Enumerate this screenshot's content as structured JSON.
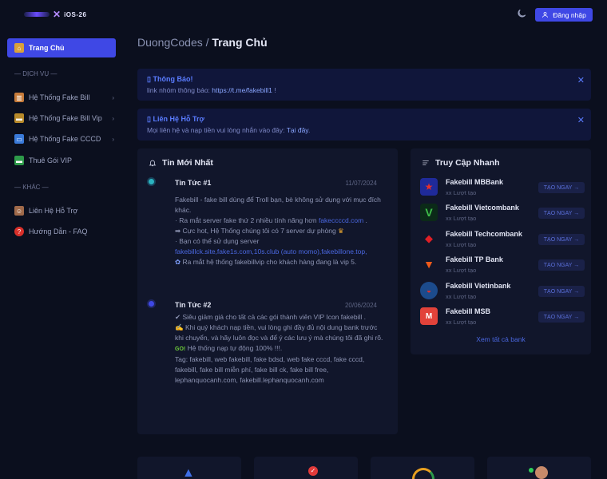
{
  "header": {
    "logo_text": "iOS-26",
    "login_label": "Đăng nhập"
  },
  "sidebar": {
    "active": {
      "label": "Trang Chủ"
    },
    "section_services": "— DỊCH VỤ —",
    "services": [
      {
        "label": "Hệ Thống Fake Bill"
      },
      {
        "label": "Hệ Thống Fake Bill Vip"
      },
      {
        "label": "Hệ Thống Fake CCCD"
      },
      {
        "label": "Thuê Gói VIP"
      }
    ],
    "section_other": "— KHÁC —",
    "other": [
      {
        "label": "Liên Hệ Hỗ Trợ"
      },
      {
        "label": "Hướng Dẫn - FAQ"
      }
    ]
  },
  "breadcrumb": {
    "root": "DuongCodes",
    "sep": " / ",
    "current": "Trang Chủ"
  },
  "alerts": [
    {
      "title": "Thông Báo!",
      "text": "link nhóm thông báo: ",
      "link": "https://t.me/fakebill1",
      "suffix": " !"
    },
    {
      "title": "Liên Hệ Hỗ Trợ",
      "text": "Mọi liên hệ và nạp tiền vui lòng nhắn vào đây: ",
      "link": "Tại đây"
    }
  ],
  "news": {
    "title": "Tin Mới Nhất",
    "items": [
      {
        "title": "Tin Tức #1",
        "date": "11/07/2024",
        "l1": "Fakebill - fake bill dùng để Troll bạn, bè không sử dụng với mục đích khác.",
        "l2": "Ra mắt server fake thứ 2 nhiều tính năng hơn ",
        "l2_link": "fakeccccd.com",
        "l2_end": " .",
        "l3": "➡ Cực hot, Hệ Thống chúng tôi có 7 server dự phòng ",
        "l4": "Bạn có thể sử dụng server",
        "l5_link": "fakebillck.site,fake1s.com,10s.club (auto momo),fakebillone.top,",
        "l6": "Ra mắt hệ thống fakebillvip cho khách hàng đang là vip 5."
      },
      {
        "title": "Tin Tức #2",
        "date": "20/06/2024",
        "l1": "✔ Siêu giảm giá cho tất cả các gói thành viên VIP Icon fakebill .",
        "l2": "Khi quý khách nạp tiền, vui lòng ghi đầy đủ nội dung bank trước khi chuyển, và hãy luôn đọc và để ý các lưu ý mà chúng tôi đã ghi rõ.",
        "l3": "Hệ thống nạp tự động 100% !!!.",
        "l4": "Tag: fakebill, web fakebill, fake bdsd, web fake cccd, fake cccd, fakebill, fake bill miễn phí, fake bill ck, fake bill free, lephanquocanh.com, fakebill.lephanquocanh.com"
      }
    ]
  },
  "quick": {
    "title": "Truy Cập Nhanh",
    "button_label": "TẠO NGAY →",
    "sub_label": "xx Lượt tạo",
    "items": [
      {
        "name": "Fakebill MBBank",
        "color": "#1f2a9a"
      },
      {
        "name": "Fakebill Vietcombank",
        "color": "#0b7a3a"
      },
      {
        "name": "Fakebill Techcombank",
        "color": "#e01f26"
      },
      {
        "name": "Fakebill TP Bank",
        "color": "#f05a1a"
      },
      {
        "name": "Fakebill Vietinbank",
        "color": "#1c4b8c"
      },
      {
        "name": "Fakebill MSB",
        "color": "#e2423a"
      }
    ],
    "see_all": "Xem tất cả bank"
  },
  "colors": {
    "accent": "#3f48e5",
    "bg": "#0b0f1e",
    "card": "#11162b"
  }
}
